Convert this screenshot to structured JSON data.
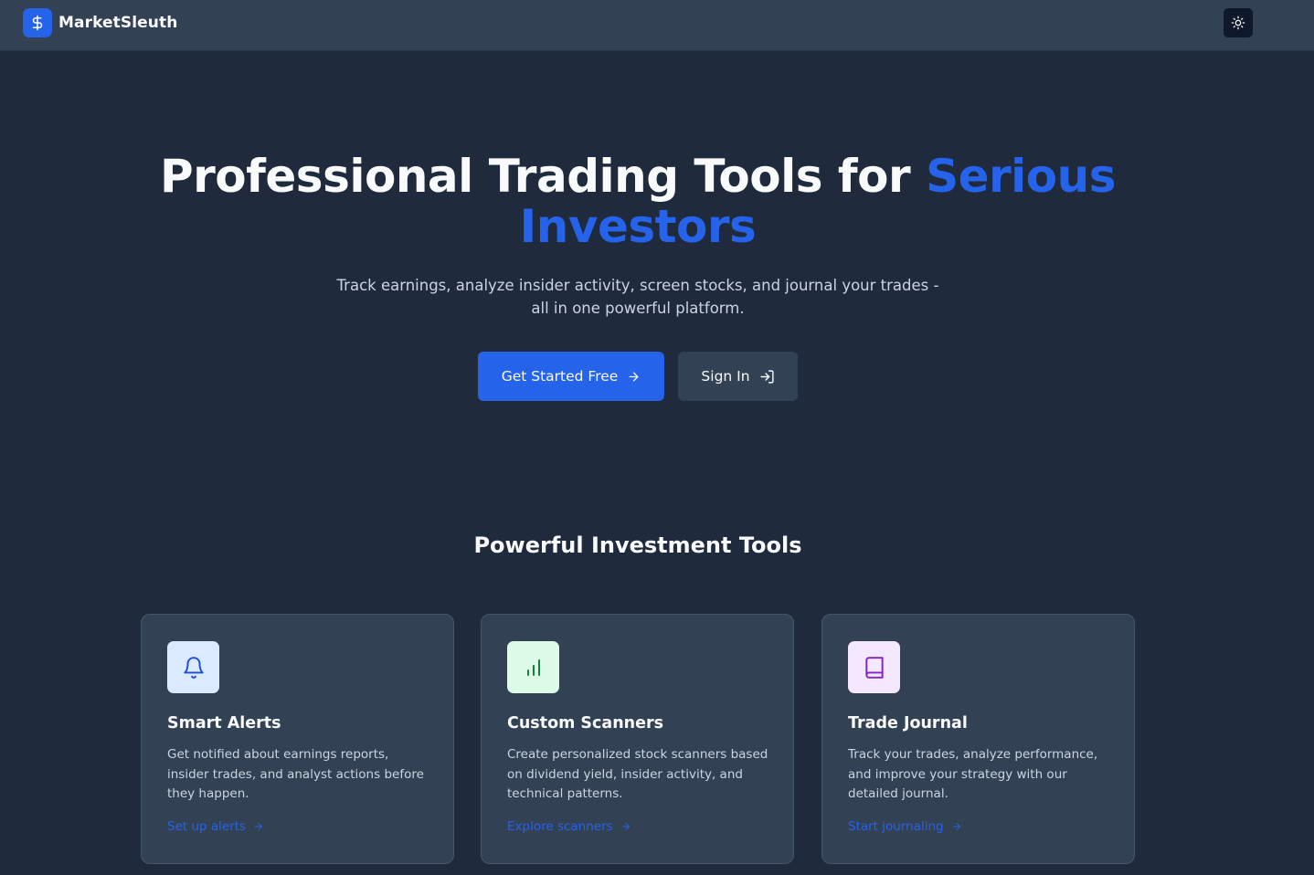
{
  "header": {
    "brand": "MarketSleuth",
    "logo_icon": "dollar-sign-icon",
    "theme_toggle_icon": "sun-icon"
  },
  "hero": {
    "title_main": "Professional Trading Tools for ",
    "title_accent": "Serious Investors",
    "subtitle": "Track earnings, analyze insider activity, screen stocks, and journal your trades - all in one powerful platform.",
    "primary_button": "Get Started Free",
    "secondary_button": "Sign In"
  },
  "features": {
    "title": "Powerful Investment Tools",
    "cards": [
      {
        "icon": "bell-icon",
        "title": "Smart Alerts",
        "description": "Get notified about earnings reports, insider trades, and analyst actions before they happen.",
        "link": "Set up alerts"
      },
      {
        "icon": "bar-chart-icon",
        "title": "Custom Scanners",
        "description": "Create personalized stock scanners based on dividend yield, insider activity, and technical patterns.",
        "link": "Explore scanners"
      },
      {
        "icon": "book-icon",
        "title": "Trade Journal",
        "description": "Track your trades, analyze performance, and improve your strategy with our detailed journal.",
        "link": "Start journaling"
      }
    ]
  },
  "colors": {
    "background": "#1f2a3c",
    "navbar": "#334155",
    "accent": "#2563eb",
    "card": "#334155",
    "alert_icon_bg": "#dbeafe",
    "scanner_icon_bg": "#dcfce7",
    "journal_icon_bg": "#f3e8ff"
  }
}
